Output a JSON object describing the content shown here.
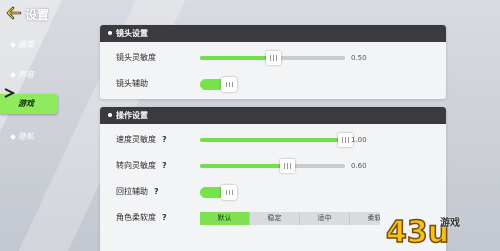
{
  "header": {
    "title": "设置"
  },
  "nav": [
    {
      "label": "画面",
      "active": false
    },
    {
      "label": "声音",
      "active": false
    },
    {
      "label": "游戏",
      "active": true
    },
    {
      "label": "隐私",
      "active": false
    }
  ],
  "camera_section": {
    "title": "镜头设置",
    "sensitivity": {
      "label": "镜头灵敏度",
      "value": "0.50",
      "level": 0.5
    },
    "assist": {
      "label": "镜头辅助",
      "on": true
    }
  },
  "control_section": {
    "title": "操作设置",
    "speed_sensitivity": {
      "label": "速度灵敏度",
      "help": "?",
      "value": "1.00",
      "level": 1.0
    },
    "turn_sensitivity": {
      "label": "转向灵敏度",
      "help": "?",
      "value": "0.60",
      "level": 0.6
    },
    "pullback_assist": {
      "label": "回拉辅助",
      "help": "?",
      "on": true
    },
    "softness": {
      "label": "角色柔软度",
      "help": "?",
      "options": [
        "默认",
        "稳定",
        "适中",
        "柔软"
      ],
      "selected": "默认"
    }
  },
  "watermark": {
    "text": "游戏",
    "brand": "43u"
  },
  "colors": {
    "accent": "#77e34b",
    "header": "#3b3b3f",
    "panel": "#f3f4f6"
  }
}
